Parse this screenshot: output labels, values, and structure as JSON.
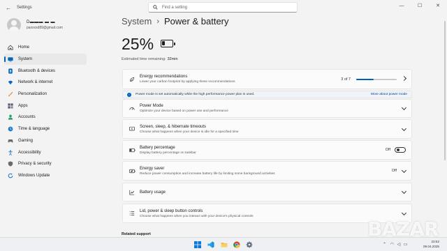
{
  "window": {
    "title": "Settings",
    "controls": [
      "—",
      "☐",
      "✕"
    ]
  },
  "search": {
    "placeholder": "Find a setting"
  },
  "profile": {
    "name": "D▬▬▬ ▬ ▬",
    "email": "paxxxxd89@gmail.com"
  },
  "sidebar": {
    "items": [
      {
        "label": "Home",
        "icon": "home-icon",
        "color": "#3b3b3b"
      },
      {
        "label": "System",
        "icon": "monitor-icon",
        "color": "#0067c0",
        "active": true
      },
      {
        "label": "Bluetooth & devices",
        "icon": "bluetooth-icon",
        "color": "#0067c0"
      },
      {
        "label": "Network & internet",
        "icon": "wifi-icon",
        "color": "#0a64c8"
      },
      {
        "label": "Personalization",
        "icon": "brush-icon",
        "color": "#d67a2c"
      },
      {
        "label": "Apps",
        "icon": "apps-icon",
        "color": "#5a5a70"
      },
      {
        "label": "Accounts",
        "icon": "person-icon",
        "color": "#2e9e6d"
      },
      {
        "label": "Time & language",
        "icon": "globe-clock-icon",
        "color": "#1f78c8"
      },
      {
        "label": "Gaming",
        "icon": "gamepad-icon",
        "color": "#6a6a6a"
      },
      {
        "label": "Accessibility",
        "icon": "accessibility-icon",
        "color": "#1f78c8"
      },
      {
        "label": "Privacy & security",
        "icon": "shield-icon",
        "color": "#6a6a6a"
      },
      {
        "label": "Windows Update",
        "icon": "update-icon",
        "color": "#1f78c8"
      }
    ]
  },
  "breadcrumb": {
    "parent": "System",
    "separator": "›",
    "current": "Power & battery"
  },
  "battery": {
    "percent_text": "25%",
    "level": 0.25,
    "estimated_label": "Estimated time remaining:",
    "estimated_value": "32min"
  },
  "cards": {
    "energy": {
      "title": "Energy recommendations",
      "subtitle": "Lower your carbon footprint by applying these recommendations",
      "count": "3 of 7",
      "progress": 0.43
    },
    "info": {
      "text": "Power mode is set automatically while the high performance power plan is used.",
      "link": "More about power mode"
    },
    "power_mode": {
      "title": "Power Mode",
      "subtitle": "Optimize your device based on power use and performance"
    },
    "screen_sleep": {
      "title": "Screen, sleep, & hibernate timeouts",
      "subtitle": "Choose what happens when your device is idle for a specified time"
    },
    "battery_percentage": {
      "title": "Battery percentage",
      "subtitle": "Display battery percentage on taskbar",
      "state": "Off"
    },
    "energy_saver": {
      "title": "Energy saver",
      "subtitle": "Reduce power consumption and increase battery life by limiting some background activities",
      "state": "Off"
    },
    "battery_usage": {
      "title": "Battery usage"
    },
    "lid_power": {
      "title": "Lid, power & sleep button controls",
      "subtitle": "Choose what happens when you interact with your device's physical controls"
    }
  },
  "related": {
    "label": "Related support"
  },
  "taskbar": {
    "apps": [
      "windows-start-icon",
      "vscode-icon",
      "file-explorer-icon",
      "chrome-icon",
      "settings-gear-icon"
    ],
    "clock_time": "23:52",
    "clock_date": "09.04.2025"
  },
  "watermark": {
    "text": "BAZAR"
  }
}
